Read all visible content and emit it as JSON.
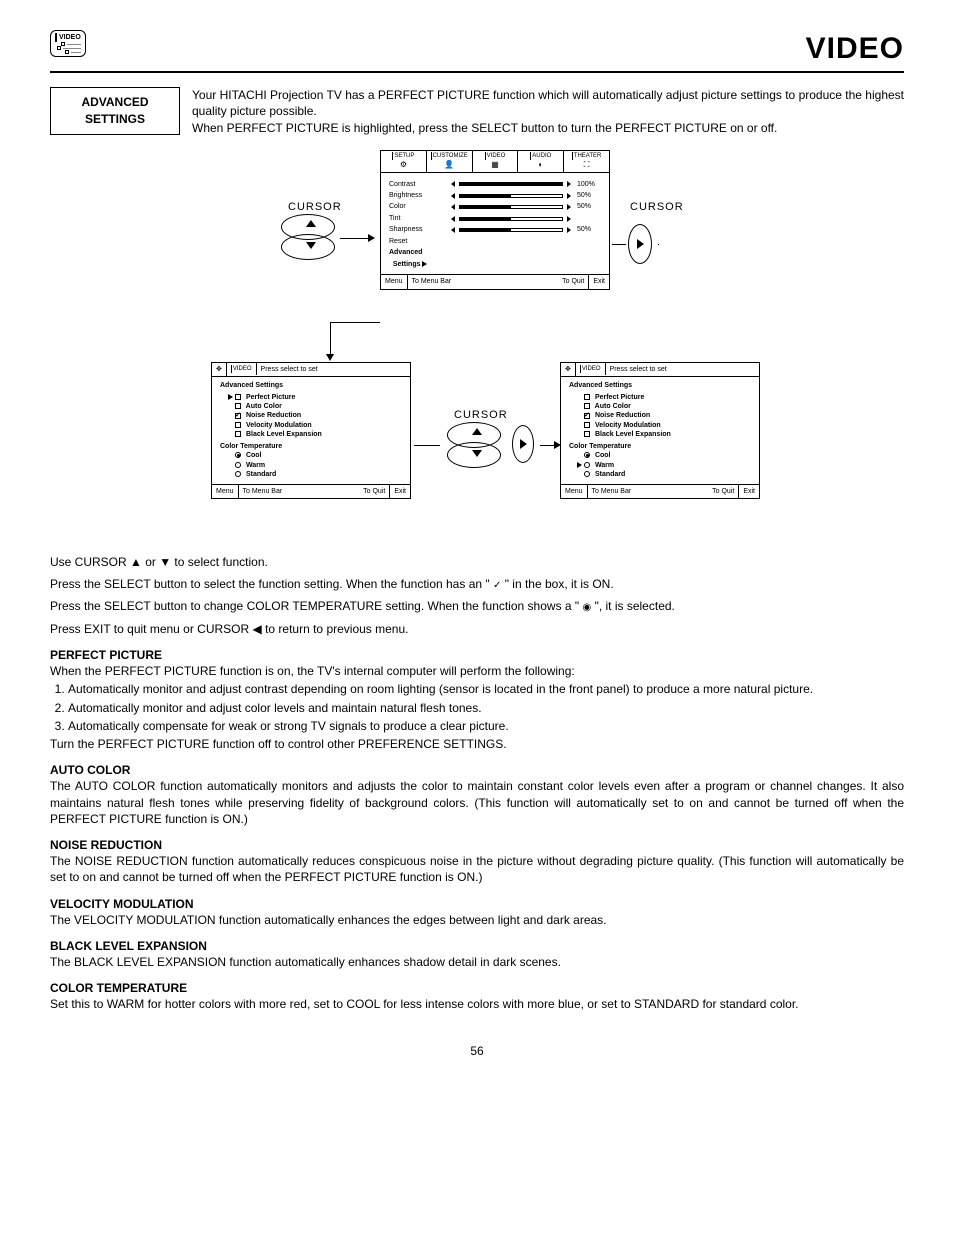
{
  "header": {
    "icon_label": "VIDEO",
    "page_title": "VIDEO",
    "box_line1": "ADVANCED",
    "box_line2": "SETTINGS",
    "intro1": "Your HITACHI Projection TV has a PERFECT PICTURE function which will automatically adjust picture settings to produce the highest quality picture possible.",
    "intro2": "When PERFECT PICTURE is highlighted, press the SELECT button to turn the PERFECT PICTURE on or off."
  },
  "osd_main": {
    "tabs": [
      "SETUP",
      "CUSTOMIZE",
      "VIDEO",
      "AUDIO",
      "THEATER"
    ],
    "rows": [
      {
        "label": "Contrast",
        "pct": 100,
        "val": "100%"
      },
      {
        "label": "Brightness",
        "pct": 50,
        "val": "50%"
      },
      {
        "label": "Color",
        "pct": 50,
        "val": "50%"
      },
      {
        "label": "Tint",
        "pct": 50,
        "val": ""
      },
      {
        "label": "Sharpness",
        "pct": 50,
        "val": "50%"
      },
      {
        "label": "Reset",
        "noslider": true
      },
      {
        "label": "Advanced",
        "noslider": true,
        "bold": true
      },
      {
        "label": "  Settings",
        "noslider": true,
        "bold": true,
        "arrow": true
      }
    ],
    "foot_menu": "Menu",
    "foot_tmb": "To Menu Bar",
    "foot_tq": "To Quit",
    "foot_exit": "Exit"
  },
  "cursor_label": "CURSOR",
  "adv_panel": {
    "press": "Press select to set",
    "title": "Advanced Settings",
    "items": [
      "Perfect Picture",
      "Auto Color",
      "Noise Reduction",
      "Velocity Modulation",
      "Black Level Expansion"
    ],
    "ct": "Color Temperature",
    "ct_opts": [
      "Cool",
      "Warm",
      "Standard"
    ],
    "left_checked": [
      false,
      false,
      true,
      false,
      false
    ],
    "right_checked": [
      false,
      false,
      true,
      false,
      false
    ],
    "left_radio": 0,
    "left_ptr": 0,
    "right_ptr_radio": 1,
    "foot_menu": "Menu",
    "foot_tmb": "To Menu Bar",
    "foot_tq": "To Quit",
    "foot_exit": "Exit"
  },
  "instructions": {
    "l1": "Use CURSOR ▲ or ▼ to select function.",
    "l2a": "Press the SELECT button to select the function setting. When the function has an \" ",
    "l2b": " \" in the box, it is ON.",
    "l3a": "Press the SELECT button to change COLOR TEMPERATURE setting.  When the function shows a \" ",
    "l3b": " \", it is selected.",
    "l4": "Press EXIT to quit menu or CURSOR ◀ to return to previous menu."
  },
  "sections": {
    "pp_h": "PERFECT PICTURE",
    "pp_intro": "When the PERFECT PICTURE function is on, the TV's internal computer will perform the following:",
    "pp_list": [
      "Automatically monitor and adjust contrast depending on room lighting (sensor is located in the front panel) to produce a more natural picture.",
      "Automatically monitor and adjust color levels and maintain natural flesh tones.",
      "Automatically compensate for weak or strong TV signals to produce a clear picture."
    ],
    "pp_out": "Turn the PERFECT PICTURE function off to control other PREFERENCE SETTINGS.",
    "ac_h": "AUTO COLOR",
    "ac_b": "The AUTO COLOR function automatically monitors and adjusts the color to maintain constant color levels even after a program or channel changes. It also maintains natural flesh tones while preserving fidelity of background colors. (This function will automatically set to on and cannot be turned off when the PERFECT PICTURE function is ON.)",
    "nr_h": "NOISE REDUCTION",
    "nr_b": "The NOISE REDUCTION function automatically reduces conspicuous noise in the picture without degrading picture quality. (This function will automatically be set to on and cannot be turned off when the PERFECT PICTURE function is ON.)",
    "vm_h": "VELOCITY MODULATION",
    "vm_b": "The VELOCITY MODULATION function automatically enhances the edges between light and dark areas.",
    "bl_h": "BLACK LEVEL EXPANSION",
    "bl_b": "The BLACK LEVEL EXPANSION function automatically enhances shadow detail in dark scenes.",
    "ct_h": "COLOR TEMPERATURE",
    "ct_b": "Set this to WARM for hotter colors with more red, set to COOL for less intense colors with more blue, or set to STANDARD for standard color."
  },
  "page_number": "56"
}
